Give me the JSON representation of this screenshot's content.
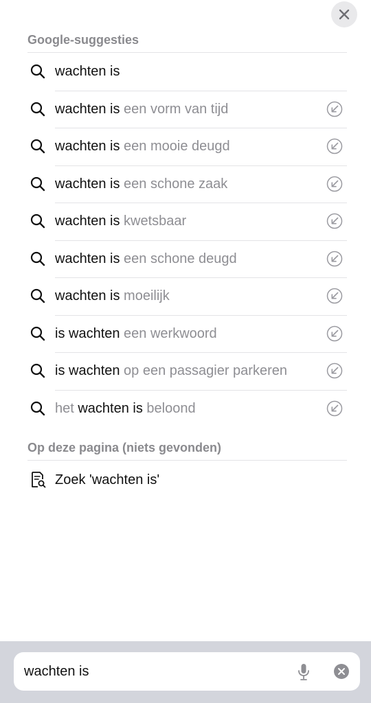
{
  "close_button": {
    "icon": "close-icon"
  },
  "google_section": {
    "header": "Google-suggesties",
    "suggestions": [
      {
        "strong": "wachten is",
        "soft": "",
        "show_fill": false
      },
      {
        "strong": "wachten is",
        "soft": " een vorm van tijd",
        "show_fill": true
      },
      {
        "strong": "wachten is",
        "soft": " een mooie deugd",
        "show_fill": true
      },
      {
        "strong": "wachten is",
        "soft": " een schone zaak",
        "show_fill": true
      },
      {
        "strong": "wachten is",
        "soft": " kwetsbaar",
        "show_fill": true
      },
      {
        "strong": "wachten is",
        "soft": " een schone deugd",
        "show_fill": true
      },
      {
        "strong": "wachten is",
        "soft": " moeilijk",
        "show_fill": true
      },
      {
        "strong": "is wachten",
        "soft": " een werkwoord",
        "show_fill": true
      },
      {
        "strong": "is wachten",
        "soft": " op een passagier parkeren",
        "show_fill": true
      },
      {
        "soft_prefix": "het ",
        "strong": "wachten is",
        "soft": " beloond",
        "show_fill": true
      }
    ]
  },
  "page_section": {
    "header": "Op deze pagina (niets gevonden)",
    "find_label": "Zoek 'wachten is'"
  },
  "search_bar": {
    "value": "wachten is",
    "mic_icon": "microphone-icon",
    "clear_icon": "clear-circle-icon"
  },
  "colors": {
    "strong_text": "#111111",
    "soft_text": "#8e8e93",
    "header_text": "#8a8a8e",
    "bottom_bar": "#d3d5dc"
  }
}
